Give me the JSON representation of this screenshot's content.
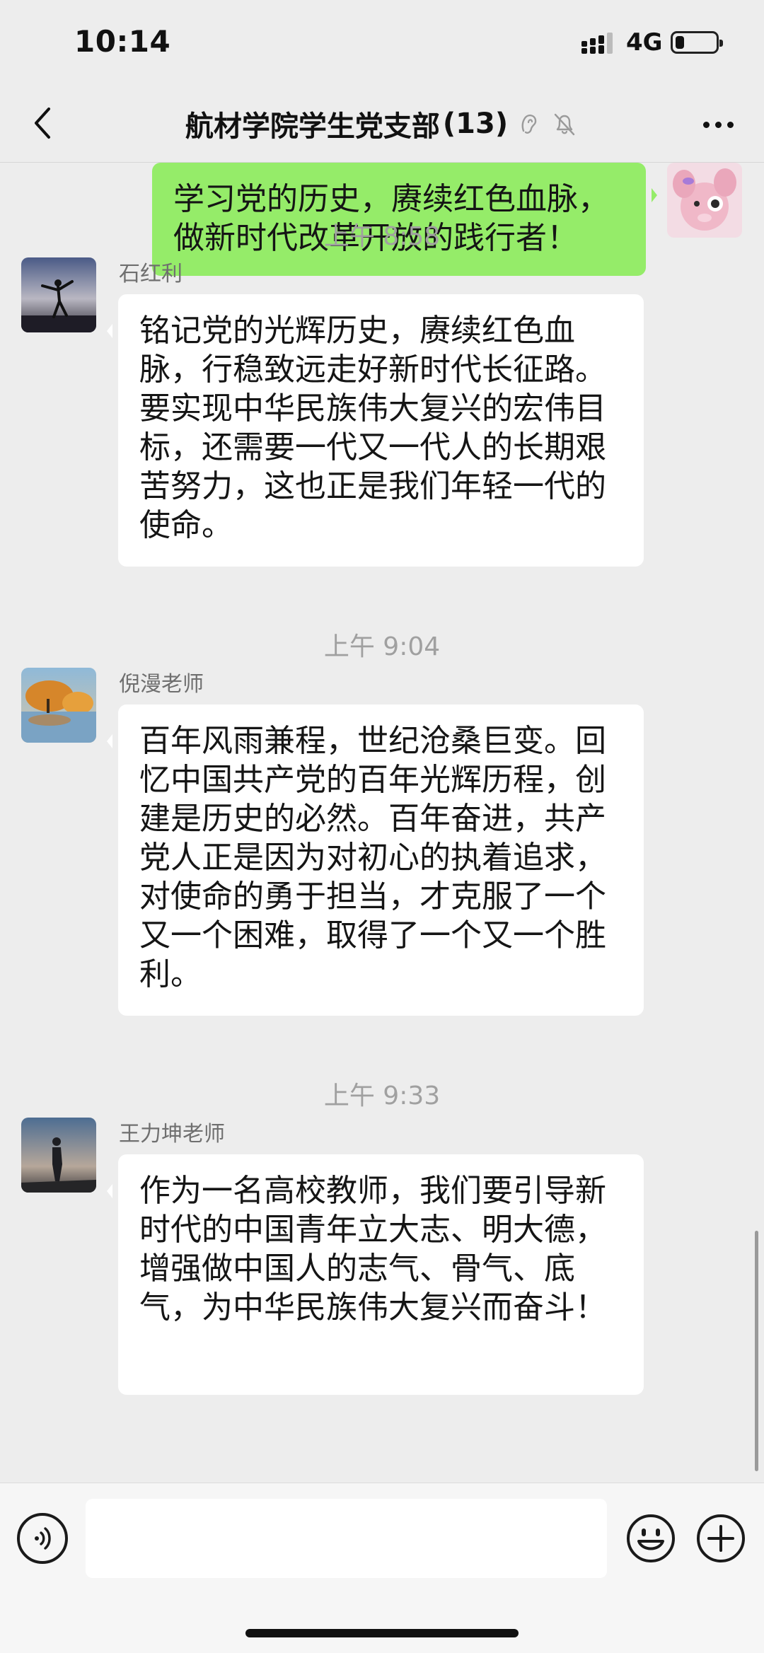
{
  "status_bar": {
    "time": "10:14",
    "network": "4G",
    "battery_level": 0.22
  },
  "nav": {
    "title": "航材学院学生党支部",
    "member_count": "(13)",
    "back_icon": "chevron-left-icon",
    "more_icon": "more-dots-icon",
    "ear_icon": "ear-icon",
    "mute_icon": "bell-muted-icon"
  },
  "messages": [
    {
      "side": "right",
      "text": "学习党的历史，赓续红色血脉，做新时代改革开放的践行者！"
    },
    {
      "type": "time",
      "text": "上午 8:58"
    },
    {
      "side": "left",
      "sender": "石红利",
      "text": "铭记党的光辉历史，赓续红色血脉，行稳致远走好新时代长征路。要实现中华民族伟大复兴的宏伟目标，还需要一代又一代人的长期艰苦努力，这也正是我们年轻一代的使命。"
    },
    {
      "type": "time",
      "text": "上午 9:04"
    },
    {
      "side": "left",
      "sender": "倪漫老师",
      "text": "百年风雨兼程，世纪沧桑巨变。回忆中国共产党的百年光辉历程，创建是历史的必然。百年奋进，共产党人正是因为对初心的执着追求，对使命的勇于担当，才克服了一个又一个困难，取得了一个又一个胜利。"
    },
    {
      "type": "time",
      "text": "上午 9:33"
    },
    {
      "side": "left",
      "sender": "王力坤老师",
      "text": "作为一名高校教师，我们要引导新时代的中国青年立大志、明大德，增强做中国人的志气、骨气、底气，为中华民族伟大复兴而奋斗！"
    }
  ],
  "input": {
    "value": "",
    "voice_icon": "voice-icon",
    "emoji_icon": "emoji-icon",
    "plus_icon": "plus-circle-icon"
  },
  "colors": {
    "background": "#ededed",
    "self_bubble": "#95ec69",
    "other_bubble": "#ffffff",
    "timestamp": "#a0a0a0"
  }
}
